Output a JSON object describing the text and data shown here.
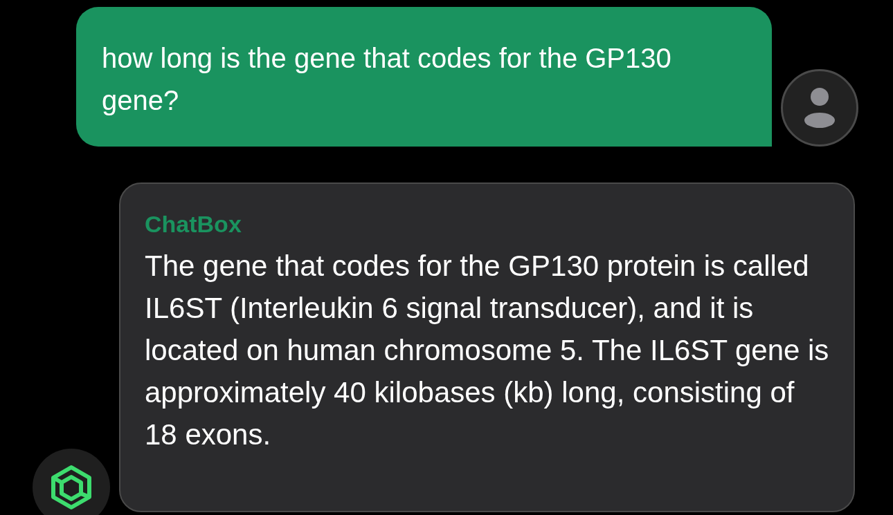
{
  "messages": [
    {
      "kind": "user",
      "text": "how long is the gene that codes for the GP130 gene?"
    },
    {
      "kind": "bot",
      "sender": "ChatBox",
      "text": "The gene that codes for the GP130 protein is called IL6ST (Interleukin 6 signal transducer), and it is located on human chromosome 5. The IL6ST gene is approximately 40 kilobases (kb) long, consisting of 18 exons."
    }
  ]
}
